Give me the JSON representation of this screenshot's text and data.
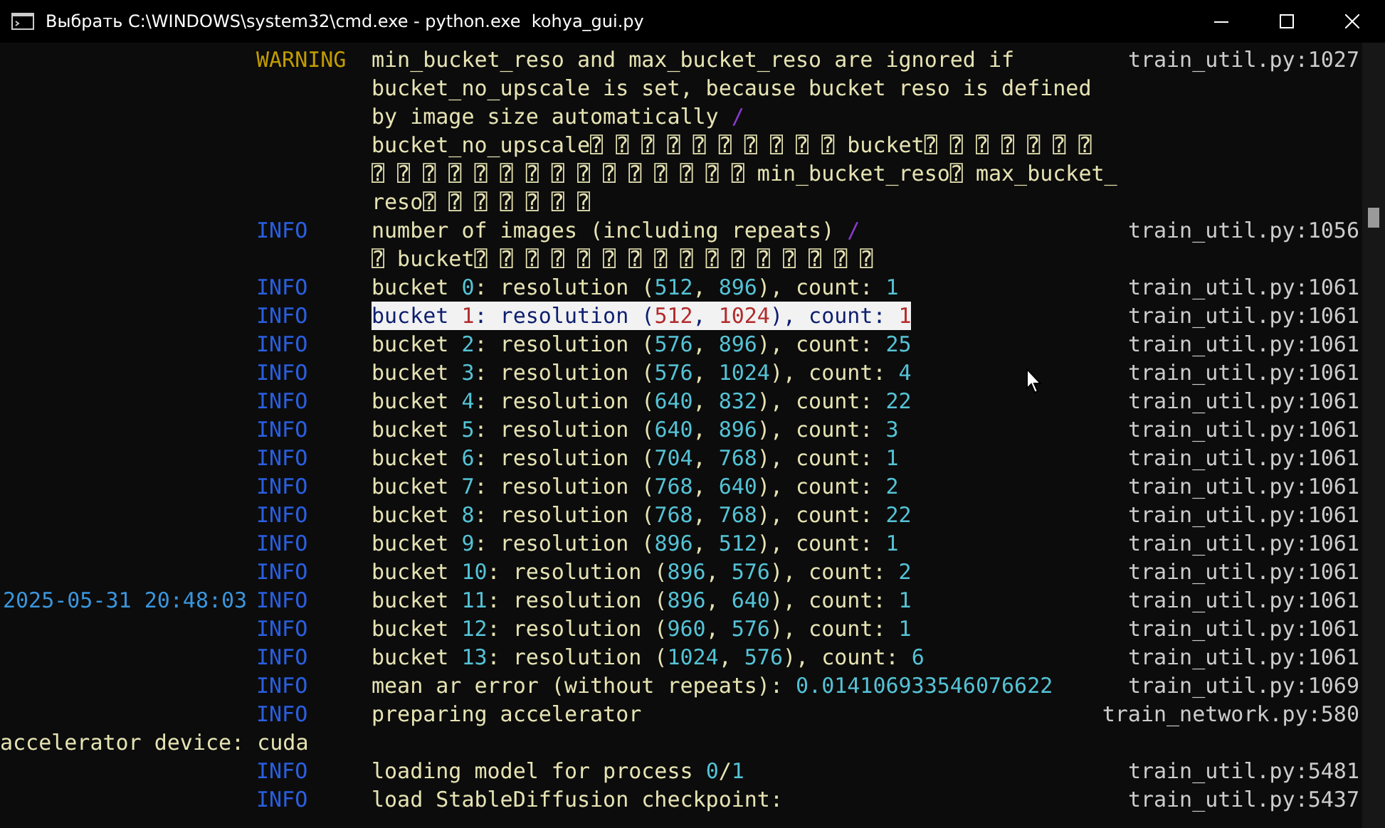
{
  "window": {
    "title": "Выбрать C:\\WINDOWS\\system32\\cmd.exe - python.exe  kohya_gui.py"
  },
  "log": [
    {
      "kind": "entry",
      "level": "WARNING",
      "selected": false,
      "source": "train_util.py:1027",
      "lines": [
        [
          {
            "kind": "text",
            "text": "min_bucket_reso and max_bucket_reso are ignored if"
          }
        ],
        [
          {
            "kind": "text",
            "text": "bucket_no_upscale is set, because bucket reso is defined"
          }
        ],
        [
          {
            "kind": "text",
            "text": "by image size automatically "
          },
          {
            "kind": "slash",
            "text": "/"
          }
        ],
        [
          {
            "kind": "text",
            "text": "bucket_no_upscale⍰ ⍰ ⍰ ⍰ ⍰ ⍰ ⍰ ⍰ ⍰ ⍰ bucket⍰ ⍰ ⍰ ⍰ ⍰ ⍰ ⍰"
          }
        ],
        [
          {
            "kind": "text",
            "text": "⍰ ⍰ ⍰ ⍰ ⍰ ⍰ ⍰ ⍰ ⍰ ⍰ ⍰ ⍰ ⍰ ⍰ ⍰ min_bucket_reso⍰ max_bucket_"
          }
        ],
        [
          {
            "kind": "text",
            "text": "reso⍰ ⍰ ⍰ ⍰ ⍰ ⍰ ⍰"
          }
        ]
      ]
    },
    {
      "kind": "entry",
      "level": "INFO",
      "selected": false,
      "source": "train_util.py:1056",
      "lines": [
        [
          {
            "kind": "text",
            "text": "number of images (including repeats) "
          },
          {
            "kind": "slash",
            "text": "/"
          }
        ],
        [
          {
            "kind": "text",
            "text": "⍰ bucket⍰ ⍰ ⍰ ⍰ ⍰ ⍰ ⍰ ⍰ ⍰ ⍰ ⍰ ⍰ ⍰ ⍰ ⍰ ⍰"
          }
        ]
      ]
    },
    {
      "kind": "entry",
      "level": "INFO",
      "selected": false,
      "source": "train_util.py:1061",
      "lines": [
        [
          {
            "kind": "text",
            "text": "bucket "
          },
          {
            "kind": "number",
            "text": "0"
          },
          {
            "kind": "text",
            "text": ": resolution ("
          },
          {
            "kind": "number",
            "text": "512"
          },
          {
            "kind": "text",
            "text": ", "
          },
          {
            "kind": "number",
            "text": "896"
          },
          {
            "kind": "text",
            "text": "), count: "
          },
          {
            "kind": "number",
            "text": "1"
          }
        ]
      ]
    },
    {
      "kind": "entry",
      "level": "INFO",
      "selected": true,
      "source": "train_util.py:1061",
      "lines": [
        [
          {
            "kind": "text",
            "text": "bucket "
          },
          {
            "kind": "number",
            "text": "1"
          },
          {
            "kind": "text",
            "text": ": resolution ("
          },
          {
            "kind": "number",
            "text": "512"
          },
          {
            "kind": "text",
            "text": ", "
          },
          {
            "kind": "number",
            "text": "1024"
          },
          {
            "kind": "text",
            "text": "), count: "
          },
          {
            "kind": "number",
            "text": "1"
          }
        ]
      ]
    },
    {
      "kind": "entry",
      "level": "INFO",
      "selected": false,
      "source": "train_util.py:1061",
      "lines": [
        [
          {
            "kind": "text",
            "text": "bucket "
          },
          {
            "kind": "number",
            "text": "2"
          },
          {
            "kind": "text",
            "text": ": resolution ("
          },
          {
            "kind": "number",
            "text": "576"
          },
          {
            "kind": "text",
            "text": ", "
          },
          {
            "kind": "number",
            "text": "896"
          },
          {
            "kind": "text",
            "text": "), count: "
          },
          {
            "kind": "number",
            "text": "25"
          }
        ]
      ]
    },
    {
      "kind": "entry",
      "level": "INFO",
      "selected": false,
      "source": "train_util.py:1061",
      "lines": [
        [
          {
            "kind": "text",
            "text": "bucket "
          },
          {
            "kind": "number",
            "text": "3"
          },
          {
            "kind": "text",
            "text": ": resolution ("
          },
          {
            "kind": "number",
            "text": "576"
          },
          {
            "kind": "text",
            "text": ", "
          },
          {
            "kind": "number",
            "text": "1024"
          },
          {
            "kind": "text",
            "text": "), count: "
          },
          {
            "kind": "number",
            "text": "4"
          }
        ]
      ]
    },
    {
      "kind": "entry",
      "level": "INFO",
      "selected": false,
      "source": "train_util.py:1061",
      "lines": [
        [
          {
            "kind": "text",
            "text": "bucket "
          },
          {
            "kind": "number",
            "text": "4"
          },
          {
            "kind": "text",
            "text": ": resolution ("
          },
          {
            "kind": "number",
            "text": "640"
          },
          {
            "kind": "text",
            "text": ", "
          },
          {
            "kind": "number",
            "text": "832"
          },
          {
            "kind": "text",
            "text": "), count: "
          },
          {
            "kind": "number",
            "text": "22"
          }
        ]
      ]
    },
    {
      "kind": "entry",
      "level": "INFO",
      "selected": false,
      "source": "train_util.py:1061",
      "lines": [
        [
          {
            "kind": "text",
            "text": "bucket "
          },
          {
            "kind": "number",
            "text": "5"
          },
          {
            "kind": "text",
            "text": ": resolution ("
          },
          {
            "kind": "number",
            "text": "640"
          },
          {
            "kind": "text",
            "text": ", "
          },
          {
            "kind": "number",
            "text": "896"
          },
          {
            "kind": "text",
            "text": "), count: "
          },
          {
            "kind": "number",
            "text": "3"
          }
        ]
      ]
    },
    {
      "kind": "entry",
      "level": "INFO",
      "selected": false,
      "source": "train_util.py:1061",
      "lines": [
        [
          {
            "kind": "text",
            "text": "bucket "
          },
          {
            "kind": "number",
            "text": "6"
          },
          {
            "kind": "text",
            "text": ": resolution ("
          },
          {
            "kind": "number",
            "text": "704"
          },
          {
            "kind": "text",
            "text": ", "
          },
          {
            "kind": "number",
            "text": "768"
          },
          {
            "kind": "text",
            "text": "), count: "
          },
          {
            "kind": "number",
            "text": "1"
          }
        ]
      ]
    },
    {
      "kind": "entry",
      "level": "INFO",
      "selected": false,
      "source": "train_util.py:1061",
      "lines": [
        [
          {
            "kind": "text",
            "text": "bucket "
          },
          {
            "kind": "number",
            "text": "7"
          },
          {
            "kind": "text",
            "text": ": resolution ("
          },
          {
            "kind": "number",
            "text": "768"
          },
          {
            "kind": "text",
            "text": ", "
          },
          {
            "kind": "number",
            "text": "640"
          },
          {
            "kind": "text",
            "text": "), count: "
          },
          {
            "kind": "number",
            "text": "2"
          }
        ]
      ]
    },
    {
      "kind": "entry",
      "level": "INFO",
      "selected": false,
      "source": "train_util.py:1061",
      "lines": [
        [
          {
            "kind": "text",
            "text": "bucket "
          },
          {
            "kind": "number",
            "text": "8"
          },
          {
            "kind": "text",
            "text": ": resolution ("
          },
          {
            "kind": "number",
            "text": "768"
          },
          {
            "kind": "text",
            "text": ", "
          },
          {
            "kind": "number",
            "text": "768"
          },
          {
            "kind": "text",
            "text": "), count: "
          },
          {
            "kind": "number",
            "text": "22"
          }
        ]
      ]
    },
    {
      "kind": "entry",
      "level": "INFO",
      "selected": false,
      "source": "train_util.py:1061",
      "lines": [
        [
          {
            "kind": "text",
            "text": "bucket "
          },
          {
            "kind": "number",
            "text": "9"
          },
          {
            "kind": "text",
            "text": ": resolution ("
          },
          {
            "kind": "number",
            "text": "896"
          },
          {
            "kind": "text",
            "text": ", "
          },
          {
            "kind": "number",
            "text": "512"
          },
          {
            "kind": "text",
            "text": "), count: "
          },
          {
            "kind": "number",
            "text": "1"
          }
        ]
      ]
    },
    {
      "kind": "entry",
      "level": "INFO",
      "selected": false,
      "source": "train_util.py:1061",
      "lines": [
        [
          {
            "kind": "text",
            "text": "bucket "
          },
          {
            "kind": "number",
            "text": "10"
          },
          {
            "kind": "text",
            "text": ": resolution ("
          },
          {
            "kind": "number",
            "text": "896"
          },
          {
            "kind": "text",
            "text": ", "
          },
          {
            "kind": "number",
            "text": "576"
          },
          {
            "kind": "text",
            "text": "), count: "
          },
          {
            "kind": "number",
            "text": "2"
          }
        ]
      ]
    },
    {
      "kind": "entry",
      "time": "2025-05-31 20:48:03",
      "level": "INFO",
      "selected": false,
      "source": "train_util.py:1061",
      "lines": [
        [
          {
            "kind": "text",
            "text": "bucket "
          },
          {
            "kind": "number",
            "text": "11"
          },
          {
            "kind": "text",
            "text": ": resolution ("
          },
          {
            "kind": "number",
            "text": "896"
          },
          {
            "kind": "text",
            "text": ", "
          },
          {
            "kind": "number",
            "text": "640"
          },
          {
            "kind": "text",
            "text": "), count: "
          },
          {
            "kind": "number",
            "text": "1"
          }
        ]
      ]
    },
    {
      "kind": "entry",
      "level": "INFO",
      "selected": false,
      "source": "train_util.py:1061",
      "lines": [
        [
          {
            "kind": "text",
            "text": "bucket "
          },
          {
            "kind": "number",
            "text": "12"
          },
          {
            "kind": "text",
            "text": ": resolution ("
          },
          {
            "kind": "number",
            "text": "960"
          },
          {
            "kind": "text",
            "text": ", "
          },
          {
            "kind": "number",
            "text": "576"
          },
          {
            "kind": "text",
            "text": "), count: "
          },
          {
            "kind": "number",
            "text": "1"
          }
        ]
      ]
    },
    {
      "kind": "entry",
      "level": "INFO",
      "selected": false,
      "source": "train_util.py:1061",
      "lines": [
        [
          {
            "kind": "text",
            "text": "bucket "
          },
          {
            "kind": "number",
            "text": "13"
          },
          {
            "kind": "text",
            "text": ": resolution ("
          },
          {
            "kind": "number",
            "text": "1024"
          },
          {
            "kind": "text",
            "text": ", "
          },
          {
            "kind": "number",
            "text": "576"
          },
          {
            "kind": "text",
            "text": "), count: "
          },
          {
            "kind": "number",
            "text": "6"
          }
        ]
      ]
    },
    {
      "kind": "entry",
      "level": "INFO",
      "selected": false,
      "source": "train_util.py:1069",
      "lines": [
        [
          {
            "kind": "text",
            "text": "mean ar error (without repeats): "
          },
          {
            "kind": "number",
            "text": "0.014106933546076622"
          }
        ]
      ]
    },
    {
      "kind": "entry",
      "level": "INFO",
      "selected": false,
      "source": "train_network.py:580",
      "lines": [
        [
          {
            "kind": "text",
            "text": "preparing accelerator"
          }
        ]
      ]
    },
    {
      "kind": "plain",
      "text": "accelerator device: cuda"
    },
    {
      "kind": "entry",
      "level": "INFO",
      "selected": false,
      "source": "train_util.py:5481",
      "lines": [
        [
          {
            "kind": "text",
            "text": "loading model for process "
          },
          {
            "kind": "number",
            "text": "0"
          },
          {
            "kind": "text",
            "text": "/"
          },
          {
            "kind": "number",
            "text": "1"
          }
        ]
      ]
    },
    {
      "kind": "entry",
      "level": "INFO",
      "selected": false,
      "source": "train_util.py:5437",
      "lines": [
        [
          {
            "kind": "text",
            "text": "load StableDiffusion checkpoint:"
          }
        ]
      ]
    }
  ]
}
